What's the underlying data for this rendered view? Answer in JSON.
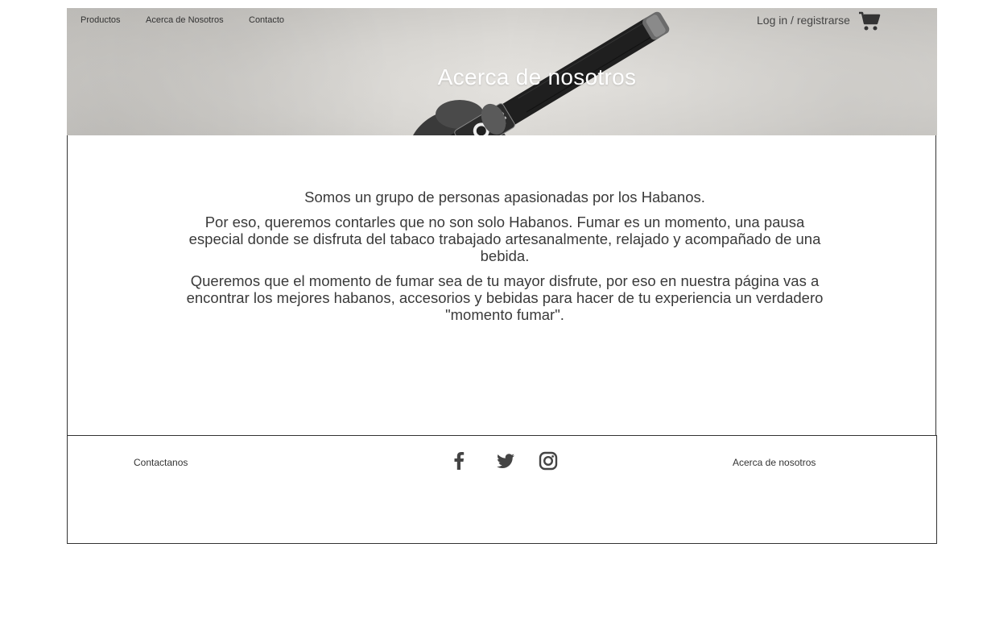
{
  "nav": {
    "items": [
      {
        "label": "Productos"
      },
      {
        "label": "Acerca de Nosotros"
      },
      {
        "label": "Contacto"
      }
    ]
  },
  "auth": {
    "label": "Log in / registrarse"
  },
  "icons": {
    "cart": "shopping-cart-icon",
    "facebook": "facebook-icon",
    "twitter": "twitter-icon",
    "instagram": "instagram-icon"
  },
  "hero": {
    "title": "Acerca de nosotros"
  },
  "about": {
    "paragraphs": [
      "Somos un grupo de personas apasionadas por los Habanos.",
      "Por eso, queremos contarles que no son solo Habanos. Fumar es un momento, una pausa especial donde se disfruta del tabaco trabajado artesanalmente, relajado y acompañado de una bebida.",
      "Queremos que el momento de fumar sea de tu mayor disfrute, por eso en nuestra página vas a encontrar los mejores habanos, accesorios y bebidas para hacer de tu experiencia un verdadero \"momento fumar\"."
    ]
  },
  "footer": {
    "contact_label": "Contactanos",
    "about_label": "Acerca de nosotros"
  },
  "colors": {
    "text": "#3a3a3a",
    "hero_title": "#ffffff",
    "border": "#333333"
  }
}
